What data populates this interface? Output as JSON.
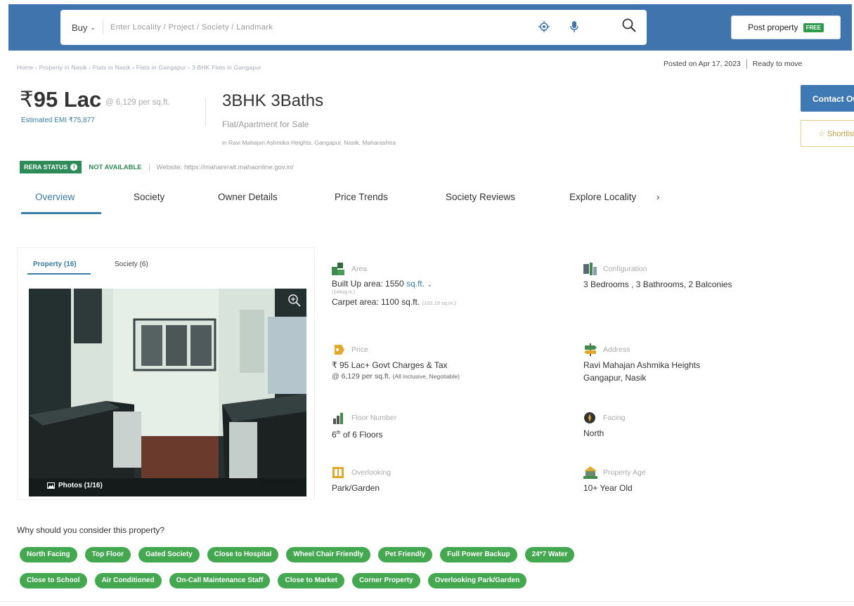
{
  "header": {
    "buy_label": "Buy",
    "search_placeholder": "Enter Locality / Project / Society / Landmark",
    "post_property_label": "Post property",
    "free_badge": "FREE"
  },
  "breadcrumb": "Home › Property in Nasik › Flats in Nasik › Flats in Gangapur › 3 BHK Flats in Gangapur",
  "posted": {
    "date": "Posted on Apr 17, 2023",
    "status": "Ready to move"
  },
  "listing": {
    "price": "95 Lac",
    "rupee": "₹",
    "per_sqft": "@ 6,129 per sq.ft.",
    "emi": "Estimated EMI ₹75,877",
    "title": "3BHK 3Baths",
    "subtitle": "Flat/Apartment for Sale",
    "address_line": "in Ravi Mahajan Ashmika Heights, Gangapur, Nasik, Maharashtra"
  },
  "actions": {
    "contact_label": "Contact Owner",
    "shortlist_label": "Shortlist"
  },
  "rera": {
    "badge": "RERA STATUS",
    "status": "NOT AVAILABLE",
    "website": "Website: https://maharerait.mahaonline.gov.in/"
  },
  "tabs": [
    {
      "label": "Overview"
    },
    {
      "label": "Society"
    },
    {
      "label": "Owner Details"
    },
    {
      "label": "Price Trends"
    },
    {
      "label": "Society Reviews"
    },
    {
      "label": "Explore Locality"
    }
  ],
  "gallery": {
    "tab_property": "Property (16)",
    "tab_society": "Society (6)",
    "photos_label": "Photos (1/16)"
  },
  "details": {
    "area": {
      "label": "Area",
      "built_up": "Built Up area: 1550",
      "unit": "sq.ft.",
      "built_up_sqm": "(144sq.m.)",
      "carpet": "Carpet area: 1100 sq.ft.",
      "carpet_sqm": "(102.19 sq.m.)"
    },
    "configuration": {
      "label": "Configuration",
      "value": "3 Bedrooms , 3 Bathrooms, 2 Balconies"
    },
    "price": {
      "label": "Price",
      "value": "₹ 95 Lac+ Govt Charges & Tax",
      "per_sqft": "@ 6,129 per sq.ft.",
      "note": "(All inclusive, Negotiable)"
    },
    "address": {
      "label": "Address",
      "line1": "Ravi Mahajan Ashmika Heights",
      "line2": "Gangapur, Nasik"
    },
    "floor": {
      "label": "Floor Number",
      "floor": "6",
      "suffix": "th",
      "of": "of 6 Floors"
    },
    "facing": {
      "label": "Facing",
      "value": "North"
    },
    "overlooking": {
      "label": "Overlooking",
      "value": "Park/Garden"
    },
    "age": {
      "label": "Property Age",
      "value": "10+ Year Old"
    }
  },
  "reasons": {
    "title": "Why should you consider this property?",
    "row1": [
      "North Facing",
      "Top Floor",
      "Gated Society",
      "Close to Hospital",
      "Wheel Chair Friendly",
      "Pet Friendly",
      "Full Power Backup",
      "24*7 Water"
    ],
    "row2": [
      "Close to School",
      "Air Conditioned",
      "On-Call Maintenance Staff",
      "Close to Market",
      "Corner Property",
      "Overlooking Park/Garden"
    ]
  },
  "colors": {
    "header_blue": "#3f74ad",
    "accent_blue": "#3a7ca5",
    "chip_green": "#43a84f",
    "rera_green": "#2e8b57"
  }
}
